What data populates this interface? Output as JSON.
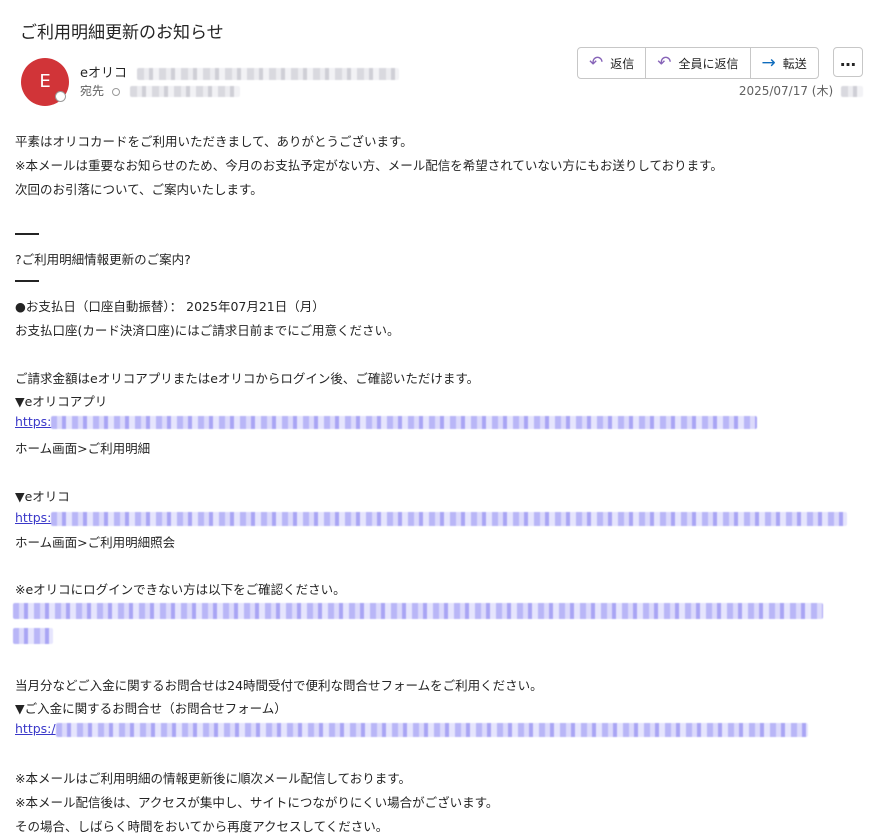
{
  "email": {
    "subject": "ご利用明細更新のお知らせ",
    "avatar_initial": "E",
    "sender_name": "eオリコ",
    "to_label": "宛先",
    "date": "2025/07/17 (木)"
  },
  "actions": {
    "reply": "返信",
    "reply_all": "全員に返信",
    "forward": "転送",
    "more": "…"
  },
  "body": {
    "intro": [
      "平素はオリコカードをご利用いただきまして、ありがとうございます。",
      "※本メールは重要なお知らせのため、今月のお支払予定がない方、メール配信を希望されていない方にもお送りしております。",
      "次回のお引落について、ご案内いたします。"
    ],
    "section_title": "?ご利用明細情報更新のご案内?",
    "payment_date": "●お支払日（口座自動振替）：  2025年07月21日（月）",
    "payment_note": "お支払口座(カード決済口座)にはご請求日前までにご用意ください。",
    "amount_note": "ご請求金額はeオリコアプリまたはeオリコからログイン後、ご確認いただけます。",
    "app_heading": "▼eオリコアプリ",
    "app_url_prefix": "https:",
    "app_path": "ホーム画面>ご利用明細",
    "web_heading": "▼eオリコ",
    "web_url_prefix": "https:",
    "web_path": "ホーム画面>ご利用明細照会",
    "login_note": "※eオリコにログインできない方は以下をご確認ください。",
    "contact_note": "当月分などご入金に関するお問合せは24時間受付で便利な問合せフォームをご利用ください。",
    "contact_heading": "▼ご入金に関するお問合せ（お問合せフォーム）",
    "contact_url_prefix": "https:/",
    "footer": [
      "※本メールはご利用明細の情報更新後に順次メール配信しております。",
      "※本メール配信後は、アクセスが集中し、サイトにつながりにくい場合がございます。",
      "その場合、しばらく時間をおいてから再度アクセスしてください。"
    ]
  }
}
